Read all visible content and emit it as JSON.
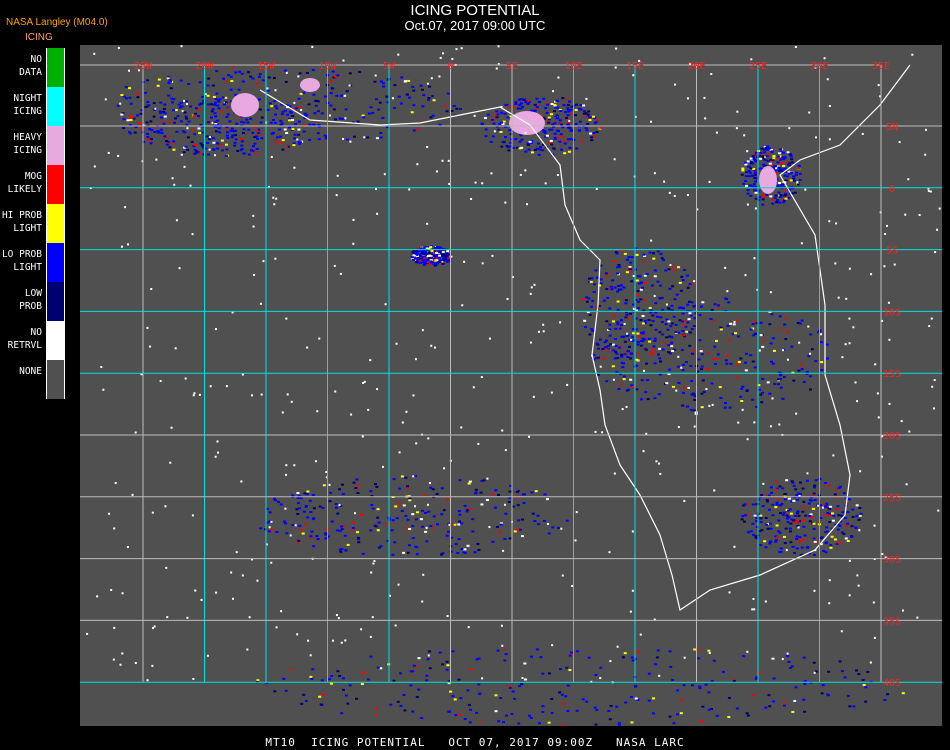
{
  "header": {
    "title": "ICING POTENTIAL",
    "subtitle": "Oct.07, 2017 09:00 UTC",
    "organization": "NASA Langley (M04.0)",
    "product": "ICING"
  },
  "legend": [
    {
      "label_1": "NO",
      "label_2": "DATA",
      "color": "#00b000"
    },
    {
      "label_1": "NIGHT",
      "label_2": "ICING",
      "color": "#00ffff"
    },
    {
      "label_1": "HEAVY",
      "label_2": "ICING",
      "color": "#e8a8e0"
    },
    {
      "label_1": "MOG",
      "label_2": "LIKELY",
      "color": "#ff0000"
    },
    {
      "label_1": "HI PROB",
      "label_2": "LIGHT",
      "color": "#ffff00"
    },
    {
      "label_1": "LO PROB",
      "label_2": "LIGHT",
      "color": "#0000ff"
    },
    {
      "label_1": "LOW",
      "label_2": "PROB",
      "color": "#000070"
    },
    {
      "label_1": "NO",
      "label_2": "RETRVL",
      "color": "#ffffff"
    },
    {
      "label_1": "NONE",
      "label_2": "",
      "color": "#505050"
    }
  ],
  "map": {
    "longitudes": [
      "25W",
      "20W",
      "15W",
      "10W",
      "5W",
      "0",
      "5E",
      "10E",
      "15E",
      "20E",
      "25E",
      "30E",
      "35E"
    ],
    "latitudes": [
      "5N",
      "0",
      "5S",
      "10S",
      "15S",
      "20S",
      "25S",
      "30S",
      "35S",
      "40S"
    ]
  },
  "footer": "MT10  ICING POTENTIAL   OCT 07, 2017 09:00Z   NASA LARC"
}
